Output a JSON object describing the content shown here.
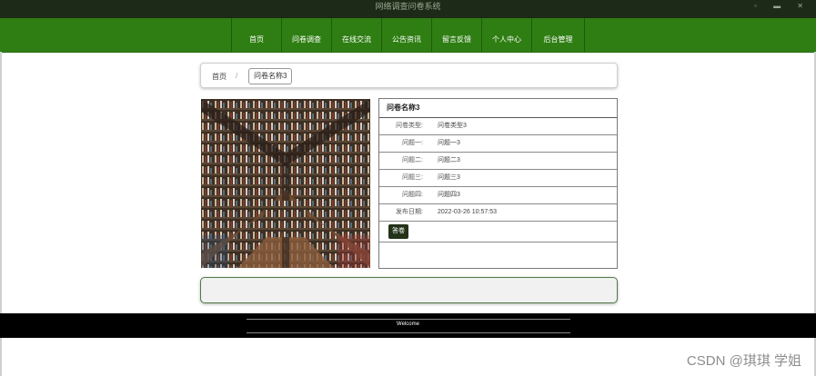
{
  "window": {
    "title": "网络调查问卷系统",
    "controls": "▫ ▬ ✕"
  },
  "nav": {
    "items": [
      "首页",
      "问卷调查",
      "在线交流",
      "公告资讯",
      "留言反馈",
      "个人中心",
      "后台管理"
    ]
  },
  "breadcrumb": {
    "home": "首页",
    "separator": "/",
    "current": "问卷名称3"
  },
  "detail": {
    "title": "问卷名称3",
    "rows": [
      {
        "label": "问卷类型:",
        "value": "问卷类型3"
      },
      {
        "label": "问题一:",
        "value": "问题一3"
      },
      {
        "label": "问题二:",
        "value": "问题二3"
      },
      {
        "label": "问题三:",
        "value": "问题三3"
      },
      {
        "label": "问题四:",
        "value": "问题四3"
      },
      {
        "label": "发布日期:",
        "value": "2022-03-26 10:57:53"
      }
    ],
    "answer_button": "答卷"
  },
  "footer": {
    "text": "Welcome"
  },
  "watermark": "CSDN @琪琪 学姐"
}
